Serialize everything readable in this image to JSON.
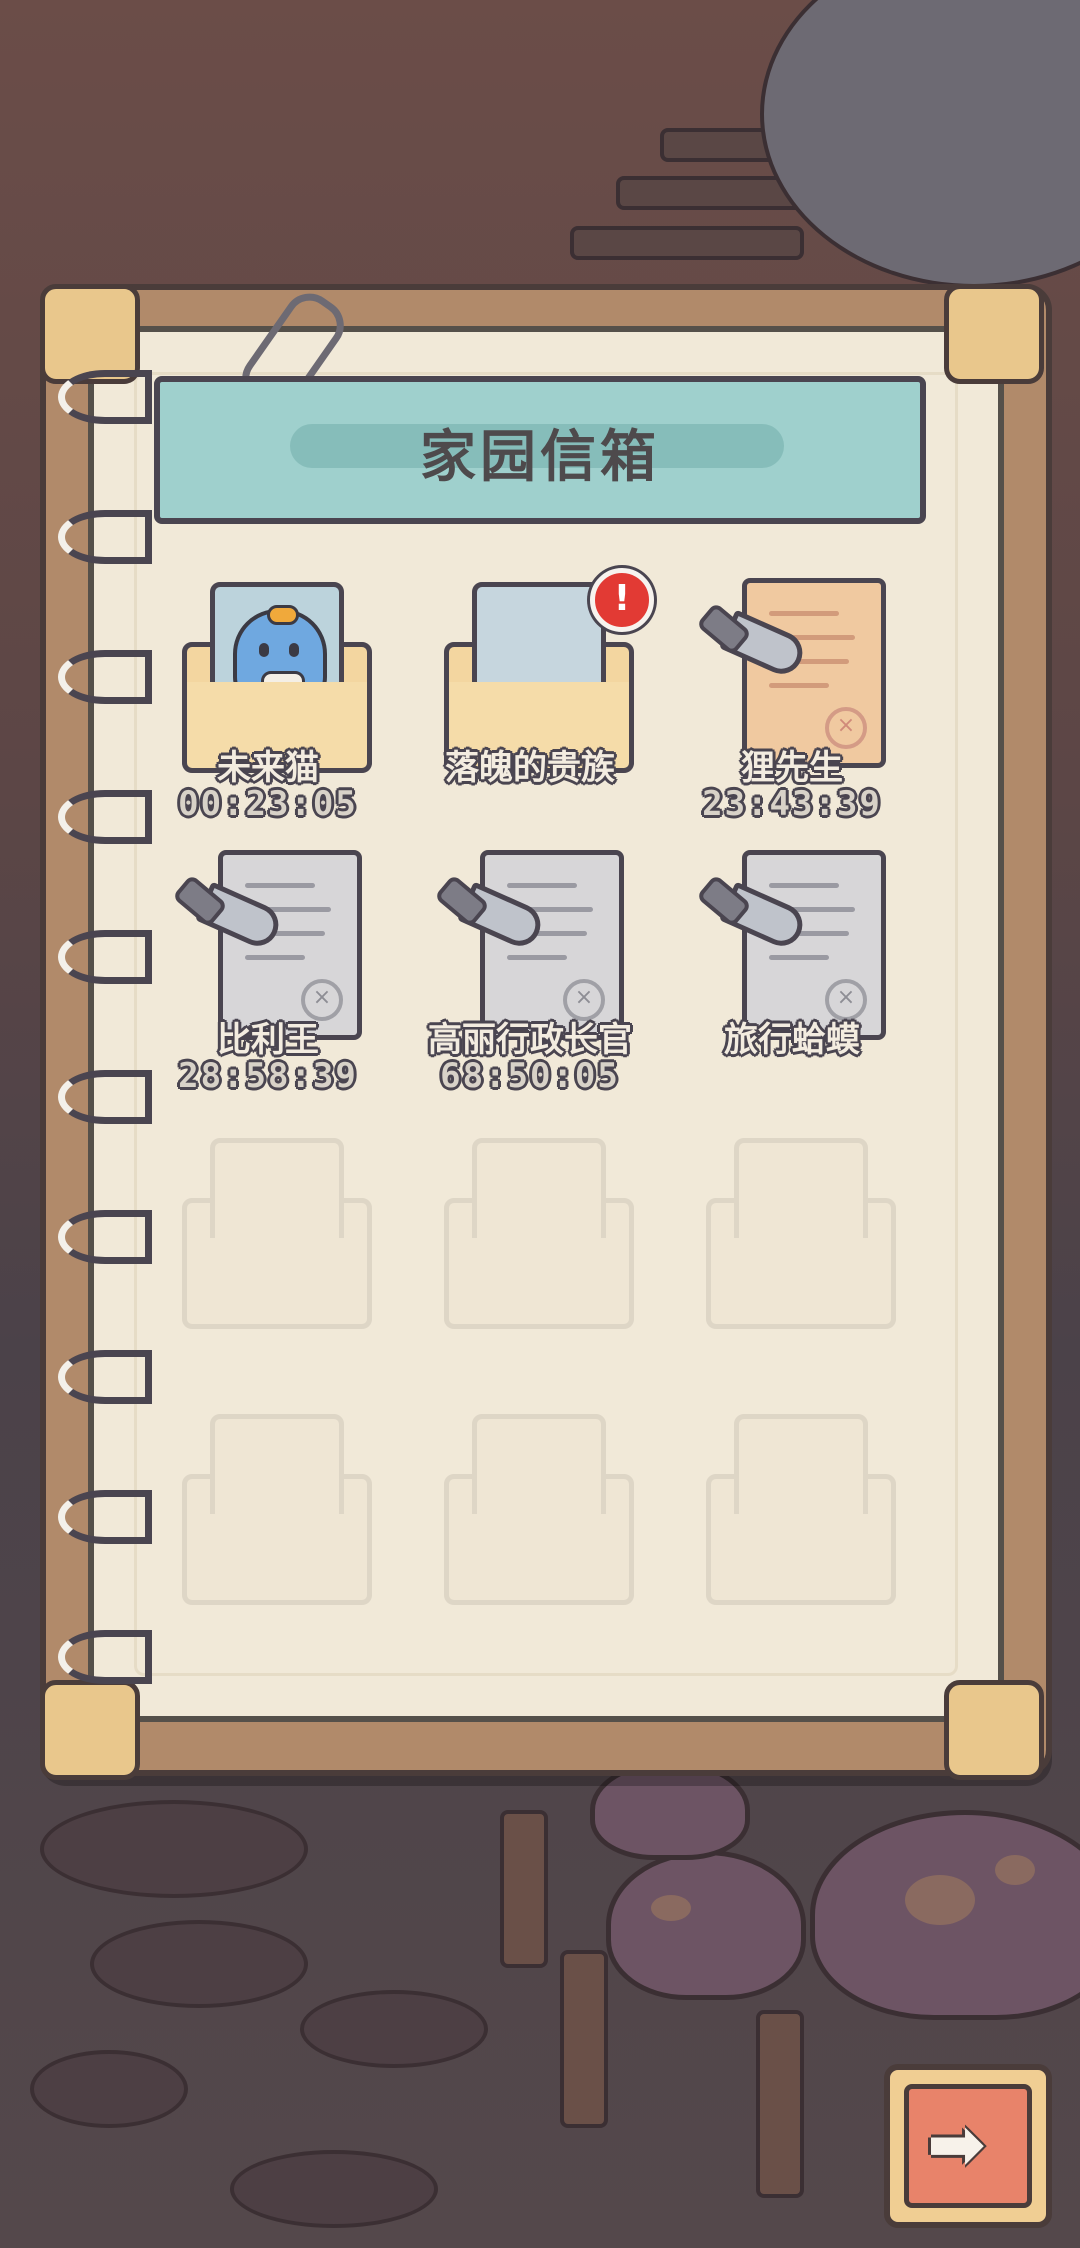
{
  "mailbox": {
    "title": "家园信箱",
    "letters": [
      {
        "sender": "未来猫",
        "timer": "00:23:05",
        "icon": "cat-portrait-envelope-icon",
        "state": "open"
      },
      {
        "sender": "落魄的贵族",
        "timer": "",
        "icon": "open-envelope-icon",
        "state": "new",
        "badge": "!"
      },
      {
        "sender": "狸先生",
        "timer": "23:43:39",
        "icon": "sealed-letter-knife-icon",
        "state": "sealed"
      },
      {
        "sender": "比利王",
        "timer": "28:58:39",
        "icon": "sealed-letter-knife-icon",
        "state": "locked"
      },
      {
        "sender": "高丽行政长官",
        "timer": "68:50:05",
        "icon": "sealed-letter-knife-icon",
        "state": "locked"
      },
      {
        "sender": "旅行蛤蟆",
        "timer": "",
        "icon": "sealed-letter-knife-icon",
        "state": "locked"
      }
    ],
    "empty_slots": 6
  },
  "navigation": {
    "next_icon": "right-arrow-icon",
    "next_glyph": "➡"
  },
  "colors": {
    "banner": "#9fd0cd",
    "page": "#f1e9d8",
    "badge": "#e23a34",
    "next_button": "#f0ce93"
  }
}
